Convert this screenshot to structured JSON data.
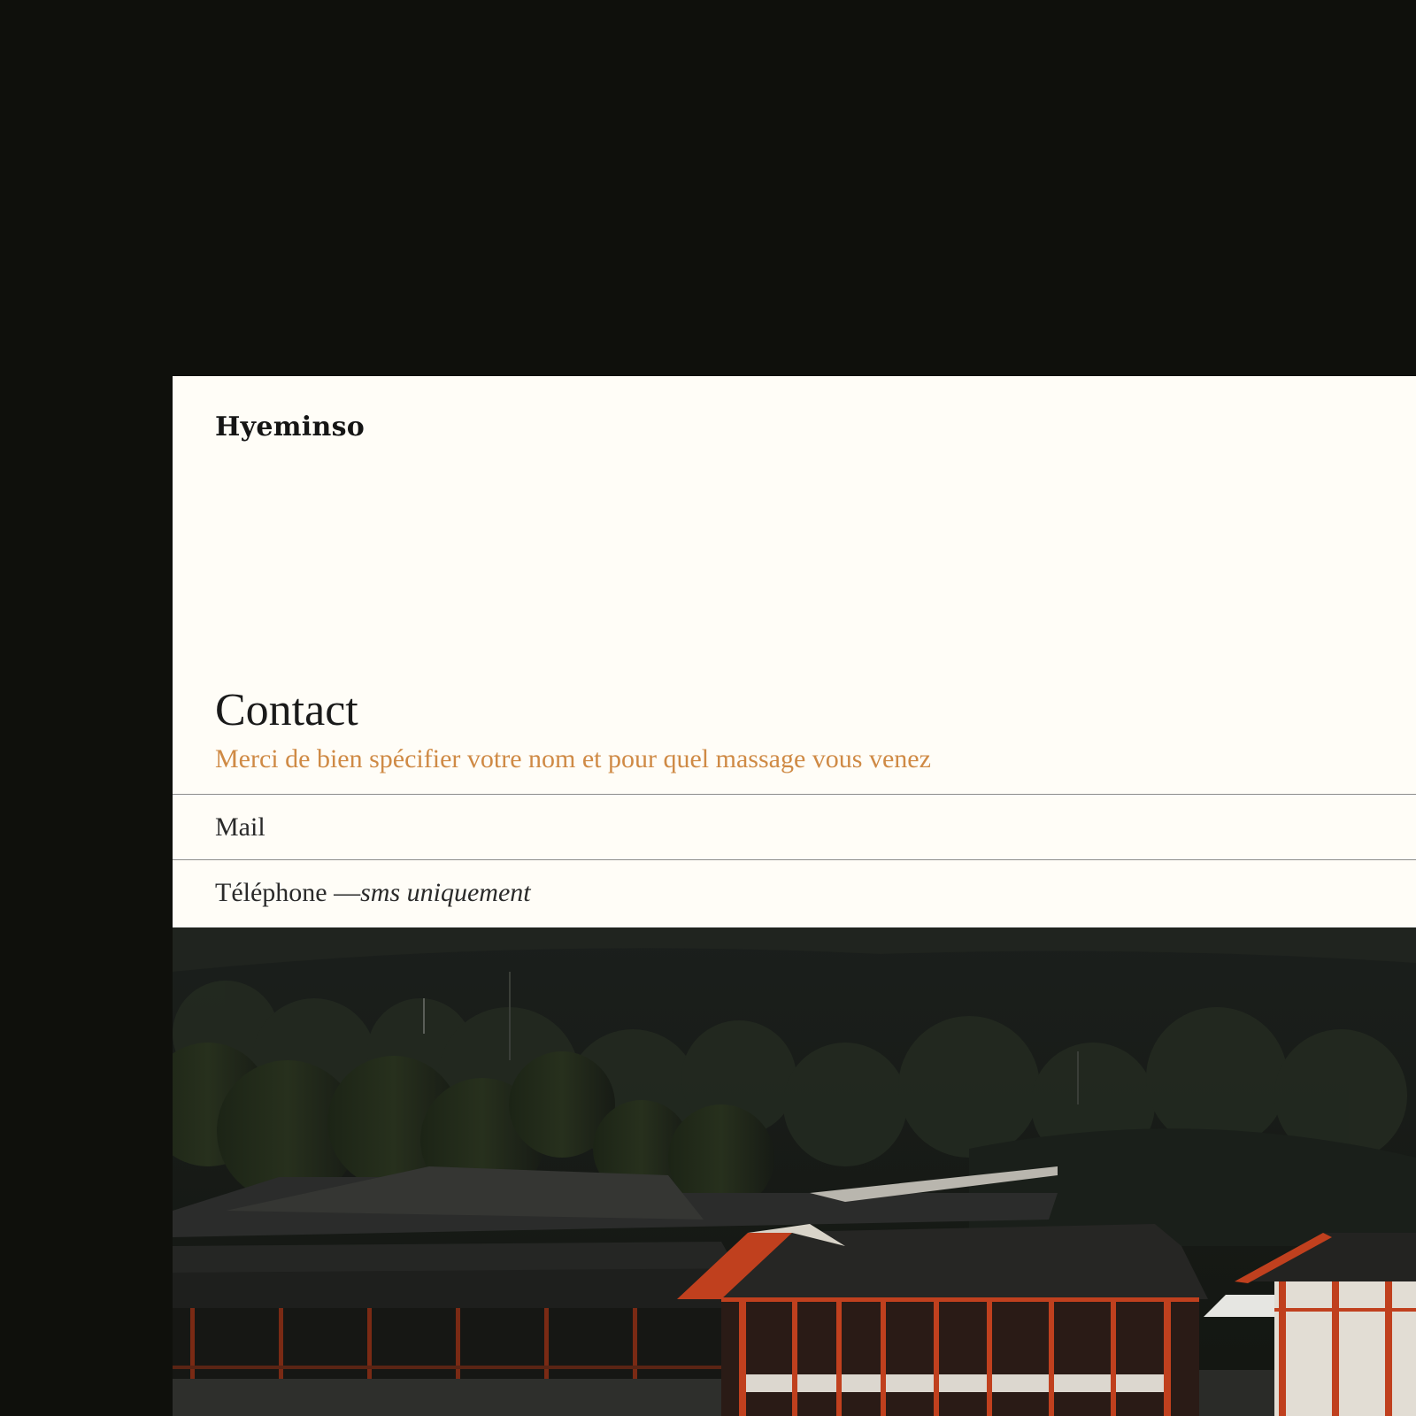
{
  "site": {
    "brand": "Hyeminso"
  },
  "contact": {
    "heading": "Contact",
    "note": "Merci de bien spécifier votre nom et pour quel massage vous venez",
    "mail_label": "Mail",
    "phone_label": "Téléphone — ",
    "phone_note": "sms uniquement"
  },
  "colors": {
    "page_background": "#0f100c",
    "panel_background": "#fffdf7",
    "accent": "#cf8a45",
    "text": "#1a1a1a",
    "divider": "#8c8c8c",
    "shrine_vermilion": "#c0401e"
  }
}
